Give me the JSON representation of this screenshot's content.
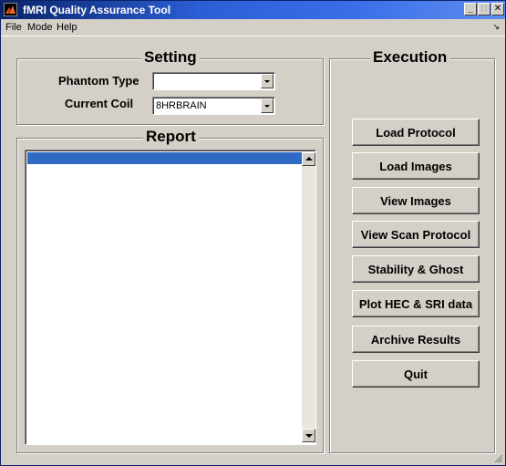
{
  "window": {
    "title": "fMRI Quality Assurance Tool"
  },
  "titlebar_buttons": {
    "minimize": "_",
    "maximize": "□",
    "close": "✕"
  },
  "menu": {
    "items": [
      "File",
      "Mode",
      "Help"
    ],
    "arrow": "↘"
  },
  "setting": {
    "title": "Setting",
    "phantom_type_label": "Phantom Type",
    "phantom_type_value": "",
    "current_coil_label": "Current Coil",
    "current_coil_value": "8HRBRAIN"
  },
  "report": {
    "title": "Report"
  },
  "execution": {
    "title": "Execution",
    "buttons": [
      "Load Protocol",
      "Load Images",
      "View Images",
      "View Scan Protocol",
      "Stability & Ghost",
      "Plot HEC & SRI data",
      "Archive Results",
      "Quit"
    ]
  },
  "colors": {
    "selection": "#316ac5",
    "titlebar": "#0a246a",
    "face": "#d4d0c8"
  }
}
